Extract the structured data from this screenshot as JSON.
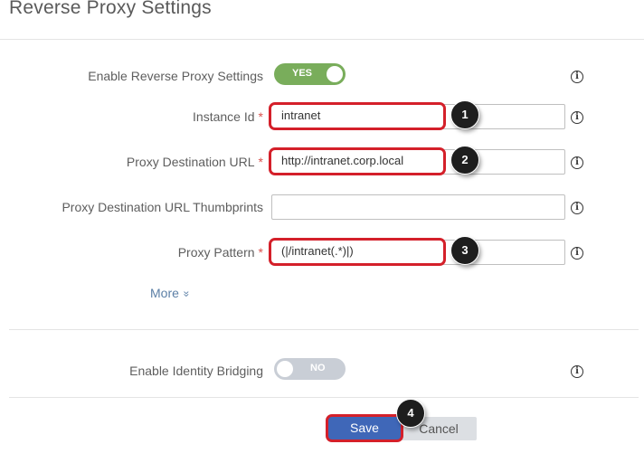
{
  "header": {
    "title": "Reverse Proxy Settings"
  },
  "reverse_proxy": {
    "enable_label": "Enable Reverse Proxy Settings",
    "enable_state": "YES",
    "instance_id_label": "Instance Id",
    "instance_id_value": "intranet",
    "dest_url_label": "Proxy Destination URL",
    "dest_url_value": "http://intranet.corp.local",
    "thumbprints_label": "Proxy Destination URL Thumbprints",
    "thumbprints_value": "",
    "pattern_label": "Proxy Pattern",
    "pattern_value": "(|/intranet(.*)|)",
    "required_mark": "*",
    "more_label": "More",
    "more_chevron": "»"
  },
  "identity_bridging": {
    "label": "Enable Identity Bridging",
    "state": "NO"
  },
  "actions": {
    "save_label": "Save",
    "cancel_label": "Cancel"
  },
  "info_glyph": "i",
  "callouts": [
    "1",
    "2",
    "3",
    "4"
  ],
  "colors": {
    "toggle_on": "#79ad5b",
    "toggle_off": "#c9ced6",
    "highlight_border": "#d4202a",
    "save_button": "#3f67b8",
    "required_asterisk": "#d9534f",
    "link": "#5b7fa6"
  },
  "icons": {
    "info": "info-circle-icon",
    "more": "double-chevron-down-icon"
  }
}
